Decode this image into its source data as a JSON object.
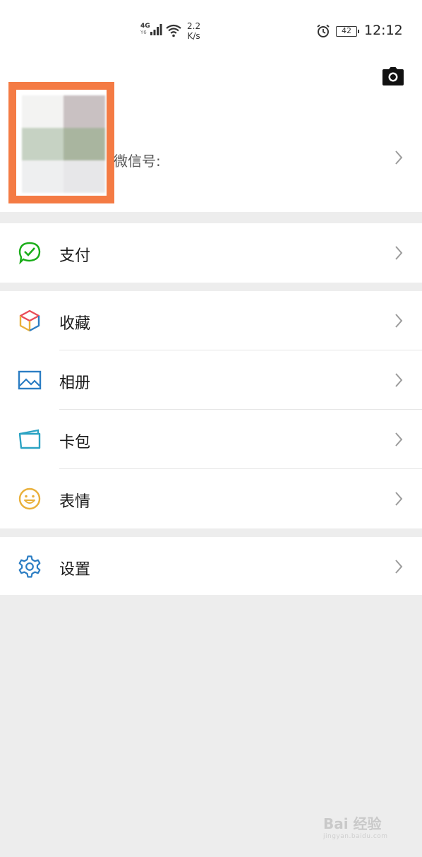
{
  "status_bar": {
    "network": "4G",
    "network_sub": "Y6",
    "speed_value": "2.2",
    "speed_unit": "K/s",
    "battery": "42",
    "time": "12:12"
  },
  "profile": {
    "wechat_id_label": "微信号:",
    "camera_icon": "camera-icon"
  },
  "menu_groups": [
    {
      "items": [
        {
          "label": "支付",
          "icon": "pay-icon"
        }
      ]
    },
    {
      "items": [
        {
          "label": "收藏",
          "icon": "favorites-icon"
        },
        {
          "label": "相册",
          "icon": "album-icon"
        },
        {
          "label": "卡包",
          "icon": "cards-icon"
        },
        {
          "label": "表情",
          "icon": "stickers-icon"
        }
      ]
    },
    {
      "items": [
        {
          "label": "设置",
          "icon": "settings-icon"
        }
      ]
    }
  ],
  "watermark": {
    "text": "Bai 经验",
    "sub": "jingyan.baidu.com"
  },
  "colors": {
    "highlight_frame": "#f47b44",
    "pay_green": "#1aad19",
    "icon_blue": "#2b7dc3",
    "sticker_yellow": "#e9b03a",
    "page_bg": "#ededed"
  }
}
